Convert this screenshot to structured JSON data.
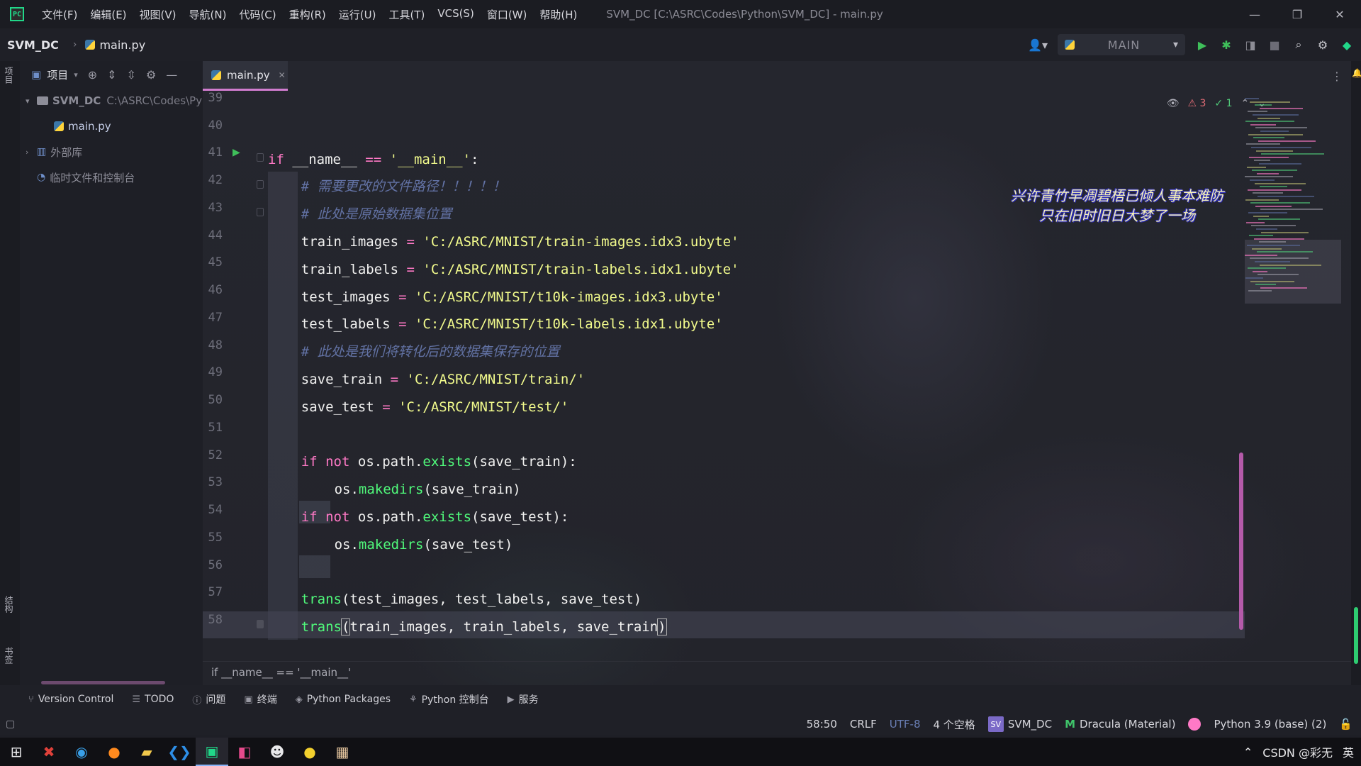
{
  "app": {
    "window_title": "SVM_DC [C:\\ASRC\\Codes\\Python\\SVM_DC] - main.py",
    "menu": [
      "文件(F)",
      "编辑(E)",
      "视图(V)",
      "导航(N)",
      "代码(C)",
      "重构(R)",
      "运行(U)",
      "工具(T)",
      "VCS(S)",
      "窗口(W)",
      "帮助(H)"
    ]
  },
  "nav": {
    "project": "SVM_DC",
    "file": "main.py",
    "run_config": "MAIN"
  },
  "left_strip": {
    "project_tab": "项目",
    "structure_tab": "结构",
    "bookmarks_tab": "书签"
  },
  "project_panel": {
    "title": "项目",
    "tree": [
      {
        "label": "SVM_DC",
        "path": "C:\\ASRC\\Codes\\Py"
      },
      {
        "label": "main.py"
      },
      {
        "label": "外部库"
      },
      {
        "label": "临时文件和控制台"
      }
    ]
  },
  "editor": {
    "tab_label": "main.py",
    "warnings": "3",
    "checks": "1",
    "breadcrumb": "if __name__ == '__main__'",
    "overlay_lines": [
      "兴许青竹早凋碧梧已倾人事本难防",
      "只在旧时旧日大梦了一场"
    ],
    "line_numbers": [
      "39",
      "40",
      "41",
      "42",
      "43",
      "44",
      "45",
      "46",
      "47",
      "48",
      "49",
      "50",
      "51",
      "52",
      "53",
      "54",
      "55",
      "56",
      "57",
      "58"
    ]
  },
  "toolwindows": [
    "Version Control",
    "TODO",
    "问题",
    "终端",
    "Python Packages",
    "Python 控制台",
    "服务"
  ],
  "status": {
    "position": "58:50",
    "line_sep": "CRLF",
    "encoding": "UTF-8",
    "indent": "4 个空格",
    "project": "SVM_DC",
    "project_badge": "SV",
    "theme": "Dracula (Material)",
    "interpreter": "Python 3.9 (base) (2)"
  },
  "tray": {
    "text": "CSDN @彩无",
    "lang": "英"
  },
  "colors": {
    "keyword": "#ff79c6",
    "string": "#f1fa8c",
    "function": "#50fa7b",
    "comment": "#6272a4",
    "accent": "#d17dd0"
  }
}
